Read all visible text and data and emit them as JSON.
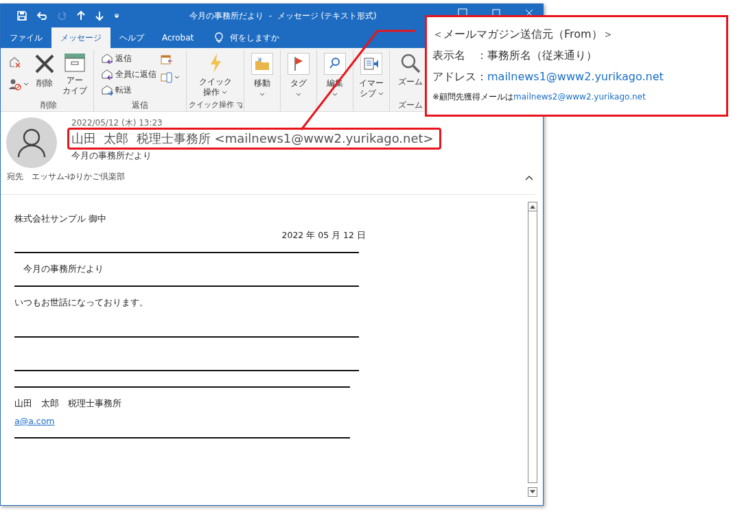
{
  "window": {
    "title": "今月の事務所だより  -  メッセージ (テキスト形式)"
  },
  "ribbon_tabs": [
    {
      "label": "ファイル",
      "selected": false
    },
    {
      "label": "メッセージ",
      "selected": true
    },
    {
      "label": "ヘルプ",
      "selected": false
    },
    {
      "label": "Acrobat",
      "selected": false
    }
  ],
  "tell_me": {
    "placeholder": "何をしますか"
  },
  "ribbon": {
    "groups": [
      {
        "label": "削除",
        "buttons": [
          "削除",
          [
            "アー",
            "カイブ"
          ]
        ]
      },
      {
        "label": "返信",
        "buttons": [
          "返信",
          "全員に返信",
          "転送"
        ]
      },
      {
        "label": "クイック操作",
        "buttons": [
          [
            "クイック",
            "操作"
          ]
        ]
      },
      {
        "buttons": [
          "移動"
        ]
      },
      {
        "buttons": [
          "タグ"
        ]
      },
      {
        "buttons": [
          "編集"
        ]
      },
      {
        "buttons": [
          [
            "イマー",
            "シブ"
          ]
        ]
      },
      {
        "label": "ズーム",
        "buttons": [
          "ズーム"
        ]
      }
    ]
  },
  "message": {
    "date": "2022/05/12 (木) 13:23",
    "sender": "山田  太郎  税理士事務所 <mailnews1@www2.yurikago.net>",
    "subject": "今月の事務所だより",
    "to_label": "宛先",
    "to": "エッサム-ゆりかご倶楽部"
  },
  "body": [
    {
      "kind": "text",
      "text": "株式会社サンプル 御中"
    },
    {
      "kind": "date",
      "text": "2022 年 05 月 12 日"
    },
    {
      "kind": "rule"
    },
    {
      "kind": "text",
      "text": "　今月の事務所だより"
    },
    {
      "kind": "rule"
    },
    {
      "kind": "text",
      "text": "いつもお世話になっております。"
    },
    {
      "kind": "blank"
    },
    {
      "kind": "rule"
    },
    {
      "kind": "blank"
    },
    {
      "kind": "rule"
    },
    {
      "kind": "shortrule"
    },
    {
      "kind": "text",
      "text": "山田　太郎　税理士事務所"
    },
    {
      "kind": "link",
      "text": "a@a.com"
    },
    {
      "kind": "shortrule"
    }
  ],
  "annotation": {
    "lines": [
      {
        "kind": "title",
        "text": "＜メールマガジン送信元（From）＞"
      },
      {
        "kind": "plain",
        "text": "表示名　：事務所名（従来通り）"
      },
      {
        "kind": "address",
        "text": "アドレス：",
        "address": "mailnews1@www2.yurikago.net"
      },
      {
        "kind": "note",
        "text": "※顧問先獲得メールは",
        "address": "mailnews2@www2.yurikago.net"
      }
    ]
  }
}
